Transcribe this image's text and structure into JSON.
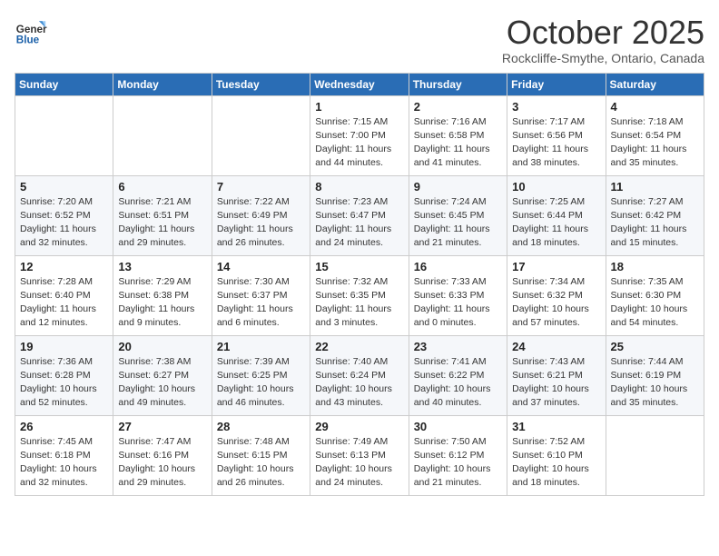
{
  "logo": {
    "line1": "General",
    "line2": "Blue"
  },
  "title": "October 2025",
  "location": "Rockcliffe-Smythe, Ontario, Canada",
  "days_of_week": [
    "Sunday",
    "Monday",
    "Tuesday",
    "Wednesday",
    "Thursday",
    "Friday",
    "Saturday"
  ],
  "weeks": [
    [
      {
        "day": "",
        "info": ""
      },
      {
        "day": "",
        "info": ""
      },
      {
        "day": "",
        "info": ""
      },
      {
        "day": "1",
        "info": "Sunrise: 7:15 AM\nSunset: 7:00 PM\nDaylight: 11 hours\nand 44 minutes."
      },
      {
        "day": "2",
        "info": "Sunrise: 7:16 AM\nSunset: 6:58 PM\nDaylight: 11 hours\nand 41 minutes."
      },
      {
        "day": "3",
        "info": "Sunrise: 7:17 AM\nSunset: 6:56 PM\nDaylight: 11 hours\nand 38 minutes."
      },
      {
        "day": "4",
        "info": "Sunrise: 7:18 AM\nSunset: 6:54 PM\nDaylight: 11 hours\nand 35 minutes."
      }
    ],
    [
      {
        "day": "5",
        "info": "Sunrise: 7:20 AM\nSunset: 6:52 PM\nDaylight: 11 hours\nand 32 minutes."
      },
      {
        "day": "6",
        "info": "Sunrise: 7:21 AM\nSunset: 6:51 PM\nDaylight: 11 hours\nand 29 minutes."
      },
      {
        "day": "7",
        "info": "Sunrise: 7:22 AM\nSunset: 6:49 PM\nDaylight: 11 hours\nand 26 minutes."
      },
      {
        "day": "8",
        "info": "Sunrise: 7:23 AM\nSunset: 6:47 PM\nDaylight: 11 hours\nand 24 minutes."
      },
      {
        "day": "9",
        "info": "Sunrise: 7:24 AM\nSunset: 6:45 PM\nDaylight: 11 hours\nand 21 minutes."
      },
      {
        "day": "10",
        "info": "Sunrise: 7:25 AM\nSunset: 6:44 PM\nDaylight: 11 hours\nand 18 minutes."
      },
      {
        "day": "11",
        "info": "Sunrise: 7:27 AM\nSunset: 6:42 PM\nDaylight: 11 hours\nand 15 minutes."
      }
    ],
    [
      {
        "day": "12",
        "info": "Sunrise: 7:28 AM\nSunset: 6:40 PM\nDaylight: 11 hours\nand 12 minutes."
      },
      {
        "day": "13",
        "info": "Sunrise: 7:29 AM\nSunset: 6:38 PM\nDaylight: 11 hours\nand 9 minutes."
      },
      {
        "day": "14",
        "info": "Sunrise: 7:30 AM\nSunset: 6:37 PM\nDaylight: 11 hours\nand 6 minutes."
      },
      {
        "day": "15",
        "info": "Sunrise: 7:32 AM\nSunset: 6:35 PM\nDaylight: 11 hours\nand 3 minutes."
      },
      {
        "day": "16",
        "info": "Sunrise: 7:33 AM\nSunset: 6:33 PM\nDaylight: 11 hours\nand 0 minutes."
      },
      {
        "day": "17",
        "info": "Sunrise: 7:34 AM\nSunset: 6:32 PM\nDaylight: 10 hours\nand 57 minutes."
      },
      {
        "day": "18",
        "info": "Sunrise: 7:35 AM\nSunset: 6:30 PM\nDaylight: 10 hours\nand 54 minutes."
      }
    ],
    [
      {
        "day": "19",
        "info": "Sunrise: 7:36 AM\nSunset: 6:28 PM\nDaylight: 10 hours\nand 52 minutes."
      },
      {
        "day": "20",
        "info": "Sunrise: 7:38 AM\nSunset: 6:27 PM\nDaylight: 10 hours\nand 49 minutes."
      },
      {
        "day": "21",
        "info": "Sunrise: 7:39 AM\nSunset: 6:25 PM\nDaylight: 10 hours\nand 46 minutes."
      },
      {
        "day": "22",
        "info": "Sunrise: 7:40 AM\nSunset: 6:24 PM\nDaylight: 10 hours\nand 43 minutes."
      },
      {
        "day": "23",
        "info": "Sunrise: 7:41 AM\nSunset: 6:22 PM\nDaylight: 10 hours\nand 40 minutes."
      },
      {
        "day": "24",
        "info": "Sunrise: 7:43 AM\nSunset: 6:21 PM\nDaylight: 10 hours\nand 37 minutes."
      },
      {
        "day": "25",
        "info": "Sunrise: 7:44 AM\nSunset: 6:19 PM\nDaylight: 10 hours\nand 35 minutes."
      }
    ],
    [
      {
        "day": "26",
        "info": "Sunrise: 7:45 AM\nSunset: 6:18 PM\nDaylight: 10 hours\nand 32 minutes."
      },
      {
        "day": "27",
        "info": "Sunrise: 7:47 AM\nSunset: 6:16 PM\nDaylight: 10 hours\nand 29 minutes."
      },
      {
        "day": "28",
        "info": "Sunrise: 7:48 AM\nSunset: 6:15 PM\nDaylight: 10 hours\nand 26 minutes."
      },
      {
        "day": "29",
        "info": "Sunrise: 7:49 AM\nSunset: 6:13 PM\nDaylight: 10 hours\nand 24 minutes."
      },
      {
        "day": "30",
        "info": "Sunrise: 7:50 AM\nSunset: 6:12 PM\nDaylight: 10 hours\nand 21 minutes."
      },
      {
        "day": "31",
        "info": "Sunrise: 7:52 AM\nSunset: 6:10 PM\nDaylight: 10 hours\nand 18 minutes."
      },
      {
        "day": "",
        "info": ""
      }
    ]
  ]
}
